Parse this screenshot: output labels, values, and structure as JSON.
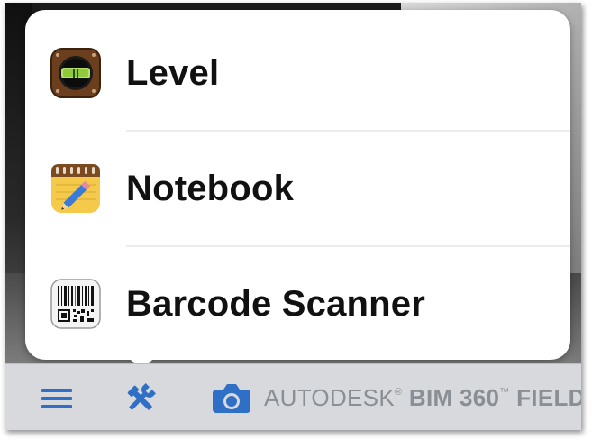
{
  "menu": {
    "items": [
      {
        "label": "Level",
        "icon": "level-app-icon"
      },
      {
        "label": "Notebook",
        "icon": "notebook-app-icon"
      },
      {
        "label": "Barcode Scanner",
        "icon": "barcode-scanner-app-icon"
      }
    ]
  },
  "toolbar": {
    "icons": [
      "hamburger-menu-icon",
      "tools-icon",
      "camera-icon"
    ],
    "brand": {
      "company": "AUTODESK",
      "registered_mark": "®",
      "product": "BIM 360",
      "trademark": "™",
      "suffix": "FIELD"
    }
  },
  "colors": {
    "accent": "#2f6fc6",
    "toolbar_bg": "#d7d9dc",
    "brand_text": "#8a8f96"
  }
}
